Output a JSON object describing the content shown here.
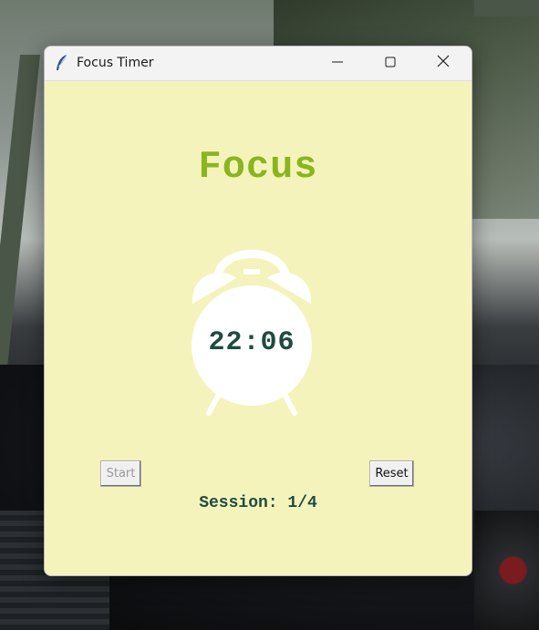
{
  "window": {
    "title": "Focus Timer",
    "controls": {
      "minimize_icon": "minimize-icon",
      "maximize_icon": "maximize-icon",
      "close_icon": "close-icon"
    }
  },
  "timer": {
    "heading": "Focus",
    "time": "22:06",
    "session_text": "Session: 1/4",
    "clock_icon": "alarm-clock-icon"
  },
  "buttons": {
    "start_label": "Start",
    "reset_label": "Reset"
  },
  "colors": {
    "background": "#f5f3bc",
    "heading": "#8ab51e",
    "timer_text": "#1e4b40"
  }
}
